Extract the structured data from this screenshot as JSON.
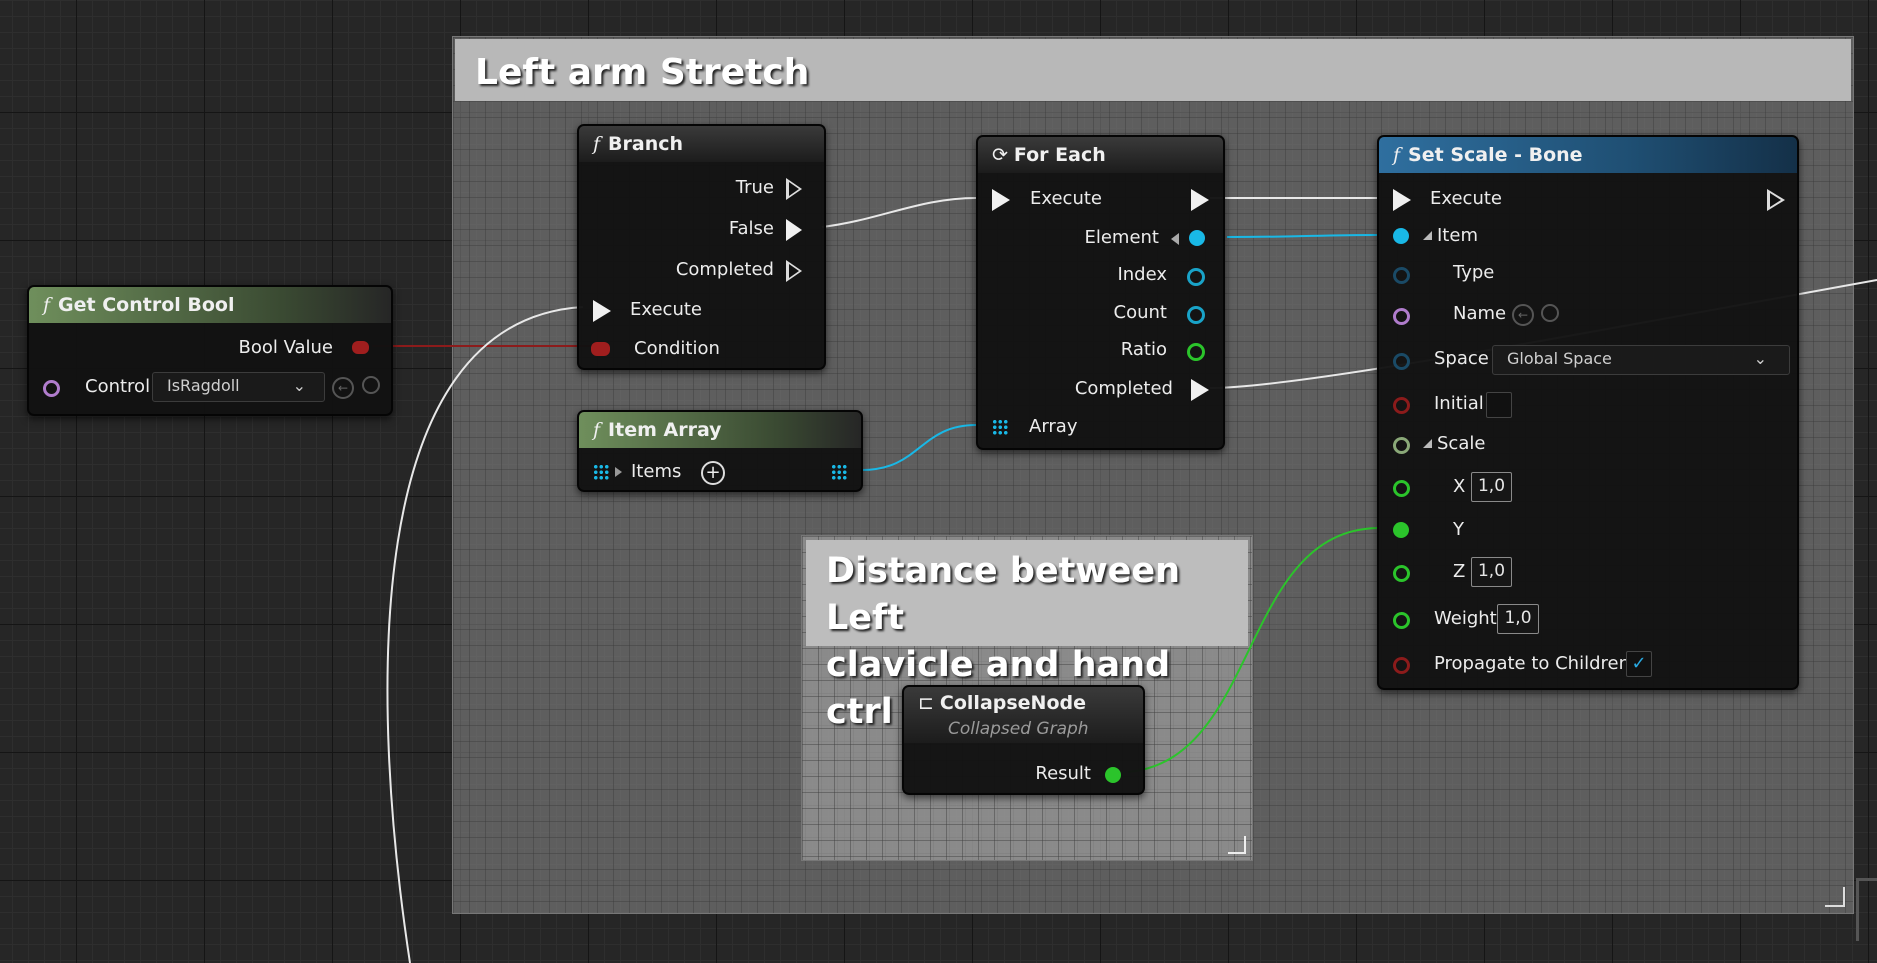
{
  "comment_main": {
    "title": "Left arm Stretch"
  },
  "comment_inner": {
    "title_line1": "Distance between Left",
    "title_line2": "clavicle and hand ctrl"
  },
  "get_control_bool": {
    "title": "Get Control Bool",
    "bool_value": "Bool Value",
    "control_label": "Control",
    "control_value": "IsRagdoll"
  },
  "branch": {
    "title": "Branch",
    "true": "True",
    "false": "False",
    "completed": "Completed",
    "execute": "Execute",
    "condition": "Condition"
  },
  "for_each": {
    "title": "For Each",
    "execute": "Execute",
    "element": "Element",
    "index": "Index",
    "count": "Count",
    "ratio": "Ratio",
    "completed": "Completed",
    "array": "Array"
  },
  "item_array": {
    "title": "Item Array",
    "items": "Items"
  },
  "collapse_node": {
    "title": "CollapseNode",
    "subtitle": "Collapsed Graph",
    "result": "Result"
  },
  "set_scale": {
    "title": "Set Scale - Bone",
    "execute": "Execute",
    "item": "Item",
    "type": "Type",
    "name": "Name",
    "space": "Space",
    "space_value": "Global Space",
    "initial": "Initial",
    "scale": "Scale",
    "x": "X",
    "x_value": "1,0",
    "y": "Y",
    "z": "Z",
    "z_value": "1,0",
    "weight": "Weight",
    "weight_value": "1,0",
    "propagate": "Propagate to Children",
    "propagate_checked": "✓"
  },
  "colors": {
    "exec": "#ffffff",
    "bool": "#8c1b1b",
    "struct": "#19b8e6",
    "int": "#1aa3a3",
    "float": "#2bc42b",
    "name": "#b07ccc"
  }
}
